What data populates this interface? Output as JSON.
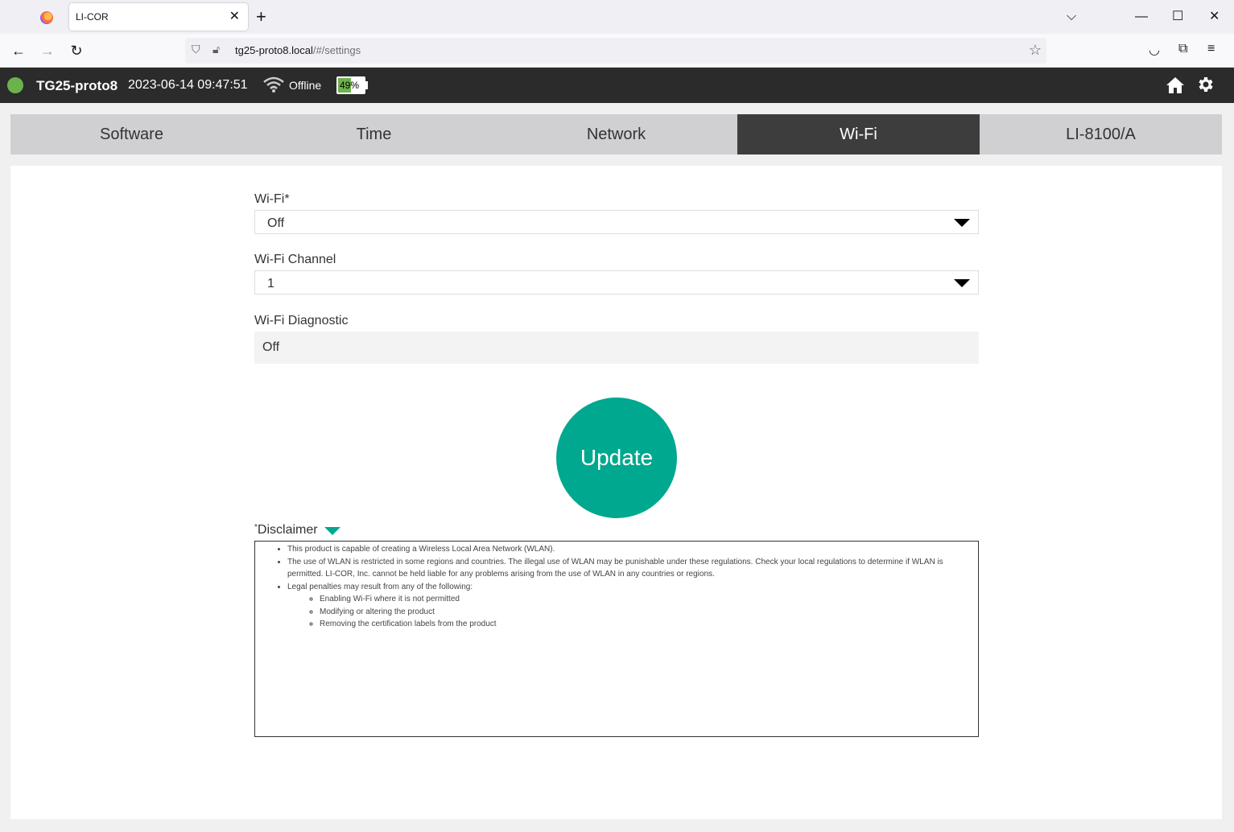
{
  "browser": {
    "tab_title": "LI-COR",
    "url_host": "tg25-proto8.local",
    "url_path": "/#/settings"
  },
  "header": {
    "device_name": "TG25-proto8",
    "datetime": "2023-06-14 09:47:51",
    "network_status": "Offline",
    "battery_percent_label": "49%",
    "battery_level": 0.49,
    "status_color": "#6cb24c"
  },
  "tabs": [
    {
      "label": "Software"
    },
    {
      "label": "Time"
    },
    {
      "label": "Network"
    },
    {
      "label": "Wi-Fi"
    },
    {
      "label": "LI-8100/A"
    }
  ],
  "form": {
    "wifi_label": "Wi-Fi*",
    "wifi_value": "Off",
    "channel_label": "Wi-Fi Channel",
    "channel_value": "1",
    "diagnostic_label": "Wi-Fi Diagnostic",
    "diagnostic_value": "Off",
    "update_label": "Update",
    "accent_color": "#00a88f"
  },
  "disclaimer": {
    "label": "Disclaimer",
    "asterisk": "*",
    "items": [
      "This product is capable of creating a Wireless Local Area Network (WLAN).",
      "The use of WLAN is restricted in some regions and countries. The illegal use of WLAN may be punishable under these regulations. Check your local regulations to determine if WLAN is permitted. LI-COR, Inc. cannot be held liable for any problems arising from the use of WLAN in any countries or regions.",
      "Legal penalties may result from any of the following:"
    ],
    "subitems": [
      "Enabling Wi-Fi where it is not permitted",
      "Modifying or altering the product",
      "Removing the certification labels from the product"
    ]
  }
}
